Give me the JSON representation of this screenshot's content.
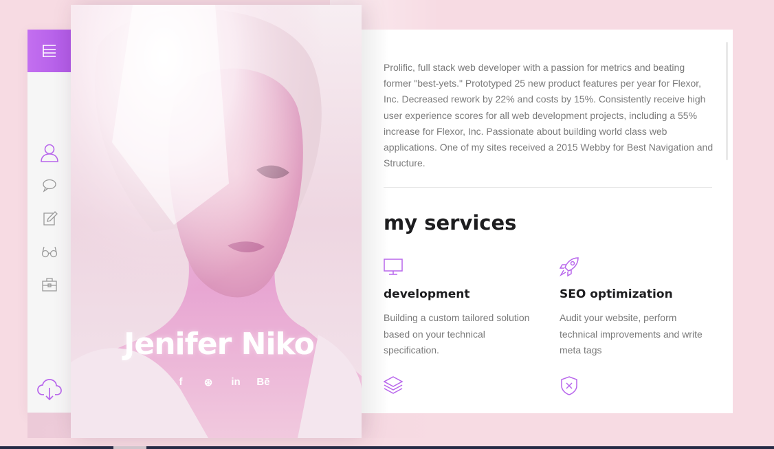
{
  "profile": {
    "name": "Jenifer Niko",
    "socials": [
      "f",
      "⊛",
      "in",
      "Bē"
    ]
  },
  "sidebar": {
    "icons": [
      "menu-icon",
      "user-icon",
      "chat-icon",
      "edit-icon",
      "glasses-icon",
      "briefcase-icon",
      "cloud-download-icon"
    ]
  },
  "about": {
    "bio": "Prolific, full stack web developer with a passion for metrics and beating former \"best-yets.\" Prototyped 25 new product features per year for Flexor, Inc. Decreased rework by 22% and costs by 15%. Consistently receive high user experience scores for all web development projects, including a 55% increase for Flexor, Inc. Passionate about building world class web applications. One of my sites received a 2015 Webby for Best Navigation and Structure."
  },
  "services": {
    "title": "my services",
    "items": [
      {
        "icon": "monitor-icon",
        "title": "development",
        "desc": "Building a custom tailored solution based on your technical specification."
      },
      {
        "icon": "rocket-icon",
        "title": "SEO optimization",
        "desc": "Audit your website, perform technical improvements and write meta tags"
      },
      {
        "icon": "layers-icon",
        "title": "",
        "desc": ""
      },
      {
        "icon": "shield-icon",
        "title": "",
        "desc": ""
      }
    ]
  },
  "colors": {
    "accent": "#b866ec",
    "page_bg": "#f7dbe3",
    "text": "#7a7a7a",
    "heading": "#1d1d1f"
  }
}
